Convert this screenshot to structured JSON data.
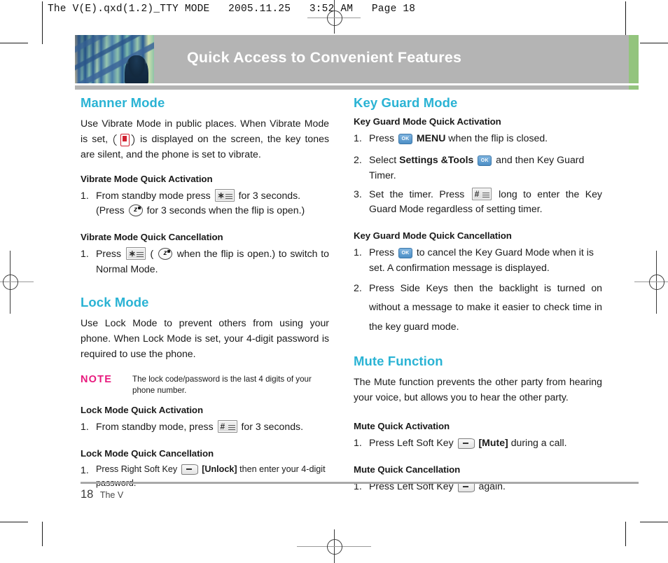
{
  "prepress": {
    "slug": "The V(E).qxd(1.2)_TTY MODE   2005.11.25   3:52 AM   Page 18"
  },
  "header": {
    "title": "Quick Access to Convenient Features",
    "accent_color": "#2ab3d4",
    "banner_bg": "#b4b4b4",
    "banner_accent": "#93c47d",
    "photo_alt": "architectural-photo"
  },
  "left_column": {
    "manner": {
      "heading": "Manner Mode",
      "intro_a": "Use Vibrate Mode in public places. When Vibrate Mode is set,",
      "intro_b": "is displayed on the screen, the key tones are silent, and the phone is set to vibrate.",
      "activation_heading": "Vibrate Mode Quick Activation",
      "activation_step_a": "From standby mode press",
      "activation_step_b": "for 3 seconds.",
      "activation_step_c": "(Press",
      "activation_step_d": "for 3 seconds when the flip is open.)",
      "cancellation_heading": "Vibrate Mode Quick Cancellation",
      "cancel_step_a": "Press",
      "cancel_step_b": "(",
      "cancel_step_c": "when the flip is open.) to switch to Normal Mode."
    },
    "lock": {
      "heading": "Lock Mode",
      "intro": "Use Lock Mode to prevent others from using your phone. When Lock Mode is set, your 4-digit password is required to use the phone.",
      "note_label": "NOTE",
      "note_text": "The lock code/password is the last 4 digits of your phone number.",
      "note_color": "#e8197d",
      "activation_heading": "Lock Mode Quick Activation",
      "activation_step_a": "From standby mode, press",
      "activation_step_b": "for 3 seconds.",
      "cancellation_heading": "Lock Mode Quick Cancellation",
      "cancel_step_a": "Press Right Soft Key",
      "cancel_step_b": "[Unlock]",
      "cancel_step_c": "then enter your 4-digit password."
    }
  },
  "right_column": {
    "keyguard": {
      "heading": "Key Guard Mode",
      "activation_heading": "Key Guard Mode Quick Activation",
      "step1_a": "Press",
      "step1_b": "MENU",
      "step1_c": "when the flip is closed.",
      "step2_a": "Select",
      "step2_b": "Settings &Tools",
      "step2_c": "and then Key Guard Timer.",
      "step3_a": "Set the timer. Press",
      "step3_b": "long to enter the Key Guard Mode regardless of setting timer.",
      "cancellation_heading": "Key Guard Mode Quick Cancellation",
      "cancel1_a": "Press",
      "cancel1_b": "to cancel the Key Guard Mode when it is set. A confirmation message is displayed.",
      "cancel2": "Press Side Keys then the backlight is turned on without a message to make it easier to check time in the key guard mode."
    },
    "mute": {
      "heading": "Mute Function",
      "intro": "The Mute function prevents the other party from hearing your voice, but allows you to hear the other party.",
      "activation_heading": "Mute Quick Activation",
      "activation_a": "Press Left Soft Key",
      "activation_b": "[Mute]",
      "activation_c": "during a call.",
      "cancellation_heading": "Mute Quick Cancellation",
      "cancel_a": "Press Left Soft Key",
      "cancel_b": "again."
    }
  },
  "footer": {
    "page_number": "18",
    "book_title": "The V"
  },
  "icons": {
    "star_key": "∗",
    "pound_key": "#",
    "sleep_key": "z",
    "ok_key": "OK"
  }
}
